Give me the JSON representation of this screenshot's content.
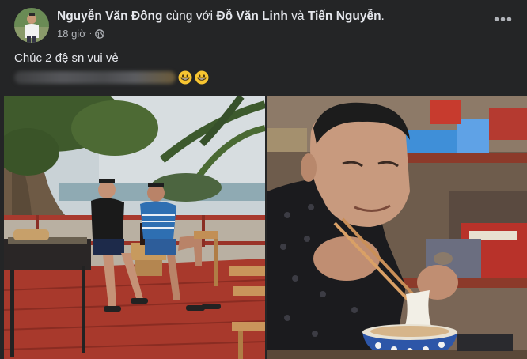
{
  "post": {
    "author": "Nguyễn Văn Đông",
    "with_text": "cùng với",
    "tagged_1": "Đỗ Văn Linh",
    "and_text": "và",
    "tagged_2": "Tiến Nguyễn",
    "period": ".",
    "time": "18 giờ",
    "dot": "·",
    "audience_icon": "globe-icon",
    "more_icon": "more-options-icon",
    "more_label": "•••",
    "caption": "Chúc 2 đệ sn vui vẻ",
    "emoji": [
      "grinning-face-icon",
      "grinning-face-icon"
    ],
    "photos": [
      {
        "name": "photo-beach-deck"
      },
      {
        "name": "photo-man-eating-noodles"
      }
    ],
    "colors": {
      "background": "#242526",
      "text_primary": "#e4e6eb",
      "text_secondary": "#b0b3b8"
    }
  }
}
